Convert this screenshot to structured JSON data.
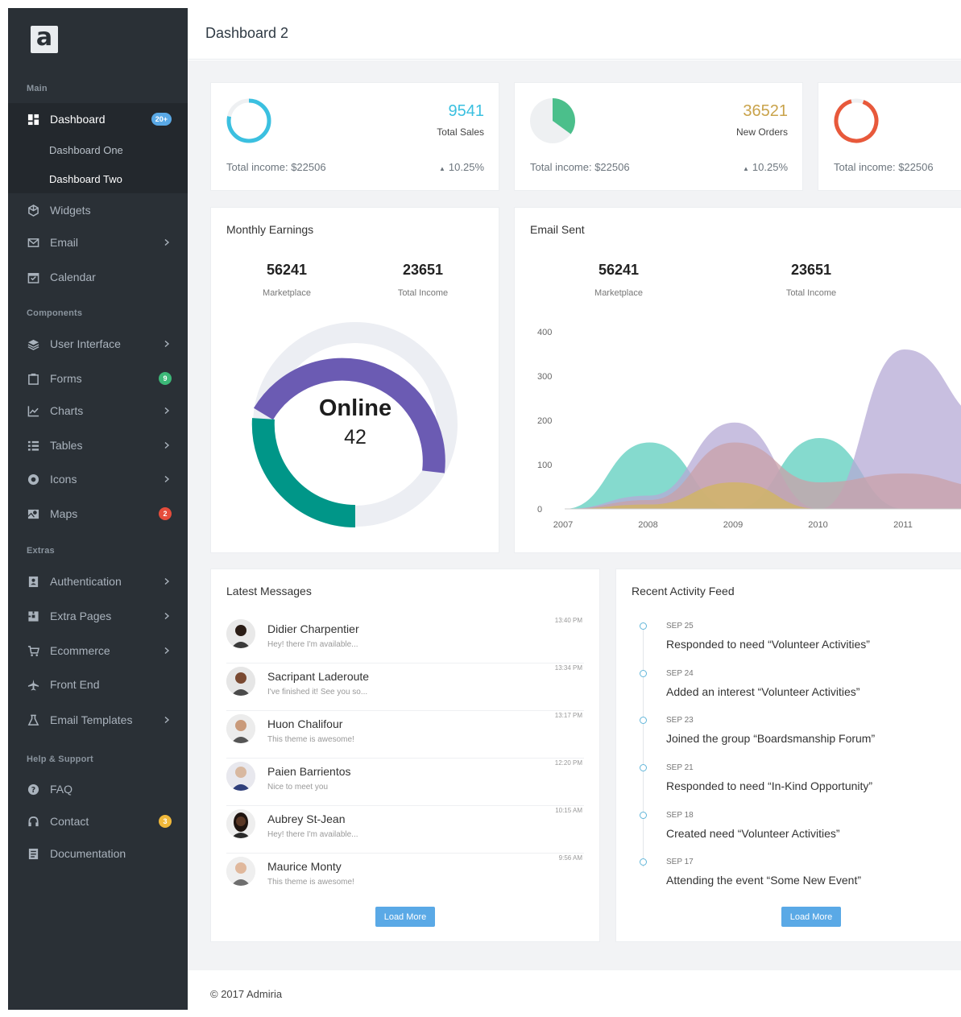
{
  "app": {
    "logo_letter": "a",
    "page_title": "Dashboard 2"
  },
  "colors": {
    "sidebar_bg": "#2a3036",
    "accent": "#5aa9e6",
    "teal": "#009688",
    "purple": "#6b5bb3",
    "cyan": "#3bc0e0",
    "green": "#4bbf8b",
    "orange": "#e8593b",
    "gold": "#c9a34b"
  },
  "sidebar": {
    "section_main": "Main",
    "dashboard": {
      "label": "Dashboard",
      "badge": "20+",
      "icon": "dashboard-icon"
    },
    "sub_one": "Dashboard One",
    "sub_two": "Dashboard Two",
    "widgets": "Widgets",
    "email": "Email",
    "calendar": "Calendar",
    "section_components": "Components",
    "user_interface": "User Interface",
    "forms": {
      "label": "Forms",
      "badge": "9"
    },
    "charts": "Charts",
    "tables": "Tables",
    "icons": "Icons",
    "maps": {
      "label": "Maps",
      "badge": "2"
    },
    "section_extras": "Extras",
    "authentication": "Authentication",
    "extra_pages": "Extra Pages",
    "ecommerce": "Ecommerce",
    "front_end": "Front End",
    "email_templates": "Email Templates",
    "section_help": "Help & Support",
    "faq": "FAQ",
    "contact": {
      "label": "Contact",
      "badge": "3"
    },
    "documentation": "Documentation"
  },
  "stats": [
    {
      "value": "9541",
      "label": "Total Sales",
      "income": "Total income: $22506",
      "change": "10.25%",
      "color": "#3bc0e0"
    },
    {
      "value": "36521",
      "label": "New Orders",
      "income": "Total income: $22506",
      "change": "10.25%",
      "color": "#c9a34b"
    },
    {
      "income": "Total income: $22506",
      "color": "#e8593b"
    }
  ],
  "monthly": {
    "title": "Monthly Earnings",
    "marketplace_value": "56241",
    "marketplace_label": "Marketplace",
    "income_value": "23651",
    "income_label": "Total Income",
    "center_title": "Online",
    "center_value": "42"
  },
  "email": {
    "title": "Email Sent",
    "marketplace_value": "56241",
    "marketplace_label": "Marketplace",
    "income_value": "23651",
    "income_label": "Total Income"
  },
  "chart_data": {
    "type": "area",
    "title": "",
    "xlabel": "",
    "ylabel": "",
    "x": [
      "2007",
      "2008",
      "2009",
      "2010",
      "2011"
    ],
    "ylim": [
      0,
      400
    ],
    "yticks": [
      "0",
      "100",
      "200",
      "300",
      "400"
    ],
    "series": [
      {
        "color": "#5ccdbd",
        "values": [
          0,
          150,
          0,
          160,
          0,
          0
        ]
      },
      {
        "color": "#b6aad6",
        "values": [
          0,
          30,
          195,
          0,
          360,
          200
        ]
      },
      {
        "color": "#c9a0a8",
        "values": [
          0,
          20,
          150,
          60,
          80,
          50
        ]
      },
      {
        "color": "#d2b55e",
        "values": [
          0,
          10,
          60,
          0,
          0,
          0
        ]
      }
    ]
  },
  "messages": {
    "title": "Latest Messages",
    "items": [
      {
        "name": "Didier Charpentier",
        "text": "Hey! there I'm available...",
        "time": "13:40 PM"
      },
      {
        "name": "Sacripant Laderoute",
        "text": "I've finished it! See you so...",
        "time": "13:34 PM"
      },
      {
        "name": "Huon Chalifour",
        "text": "This theme is awesome!",
        "time": "13:17 PM"
      },
      {
        "name": "Paien Barrientos",
        "text": "Nice to meet you",
        "time": "12:20 PM"
      },
      {
        "name": "Aubrey St-Jean",
        "text": "Hey! there I'm available...",
        "time": "10:15 AM"
      },
      {
        "name": "Maurice Monty",
        "text": "This theme is awesome!",
        "time": "9:56 AM"
      }
    ],
    "load_more": "Load More"
  },
  "feed": {
    "title": "Recent Activity Feed",
    "items": [
      {
        "date": "SEP 25",
        "text": "Responded to need “Volunteer Activities”"
      },
      {
        "date": "SEP 24",
        "text": "Added an interest “Volunteer Activities”"
      },
      {
        "date": "SEP 23",
        "text": "Joined the group “Boardsmanship Forum”"
      },
      {
        "date": "SEP 21",
        "text": "Responded to need “In-Kind Opportunity”"
      },
      {
        "date": "SEP 18",
        "text": "Created need “Volunteer Activities”"
      },
      {
        "date": "SEP 17",
        "text": "Attending the event “Some New Event”"
      }
    ],
    "load_more": "Load More"
  },
  "footer": {
    "text": "© 2017 Admiria"
  }
}
